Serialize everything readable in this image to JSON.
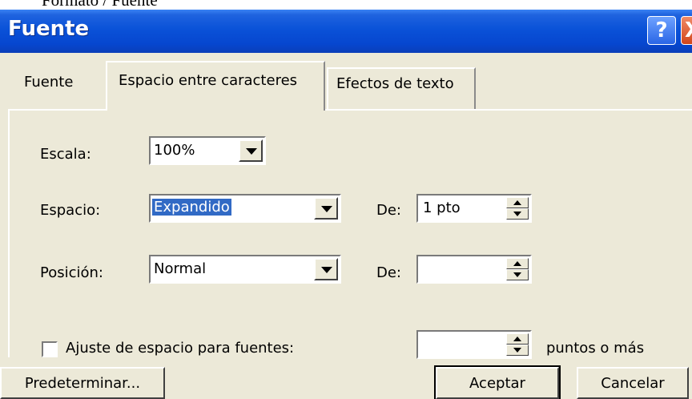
{
  "caption": "Formato / Fuente",
  "window": {
    "title": "Fuente",
    "help_glyph": "?",
    "close_glyph": "X"
  },
  "tabs": [
    {
      "label": "Fuente",
      "active": false
    },
    {
      "label": "Espacio entre caracteres",
      "active": true
    },
    {
      "label": "Efectos de texto",
      "active": false
    }
  ],
  "form": {
    "escala": {
      "label": "Escala:",
      "value": "100%"
    },
    "espacio": {
      "label": "Espacio:",
      "value": "Expandido",
      "de_label": "De:",
      "de_value": "1 pto"
    },
    "posicion": {
      "label": "Posición:",
      "value": "Normal",
      "de_label": "De:",
      "de_value": ""
    },
    "ajuste": {
      "label": "Ajuste de espacio para fuentes:",
      "checked": false,
      "value": "",
      "suffix": "puntos o más"
    }
  },
  "buttons": {
    "default": "Predeterminar...",
    "ok": "Aceptar",
    "cancel": "Cancelar"
  },
  "colors": {
    "titlebar": "#0a52d8",
    "dialog_bg": "#ece9d8",
    "selection": "#316ac5"
  }
}
